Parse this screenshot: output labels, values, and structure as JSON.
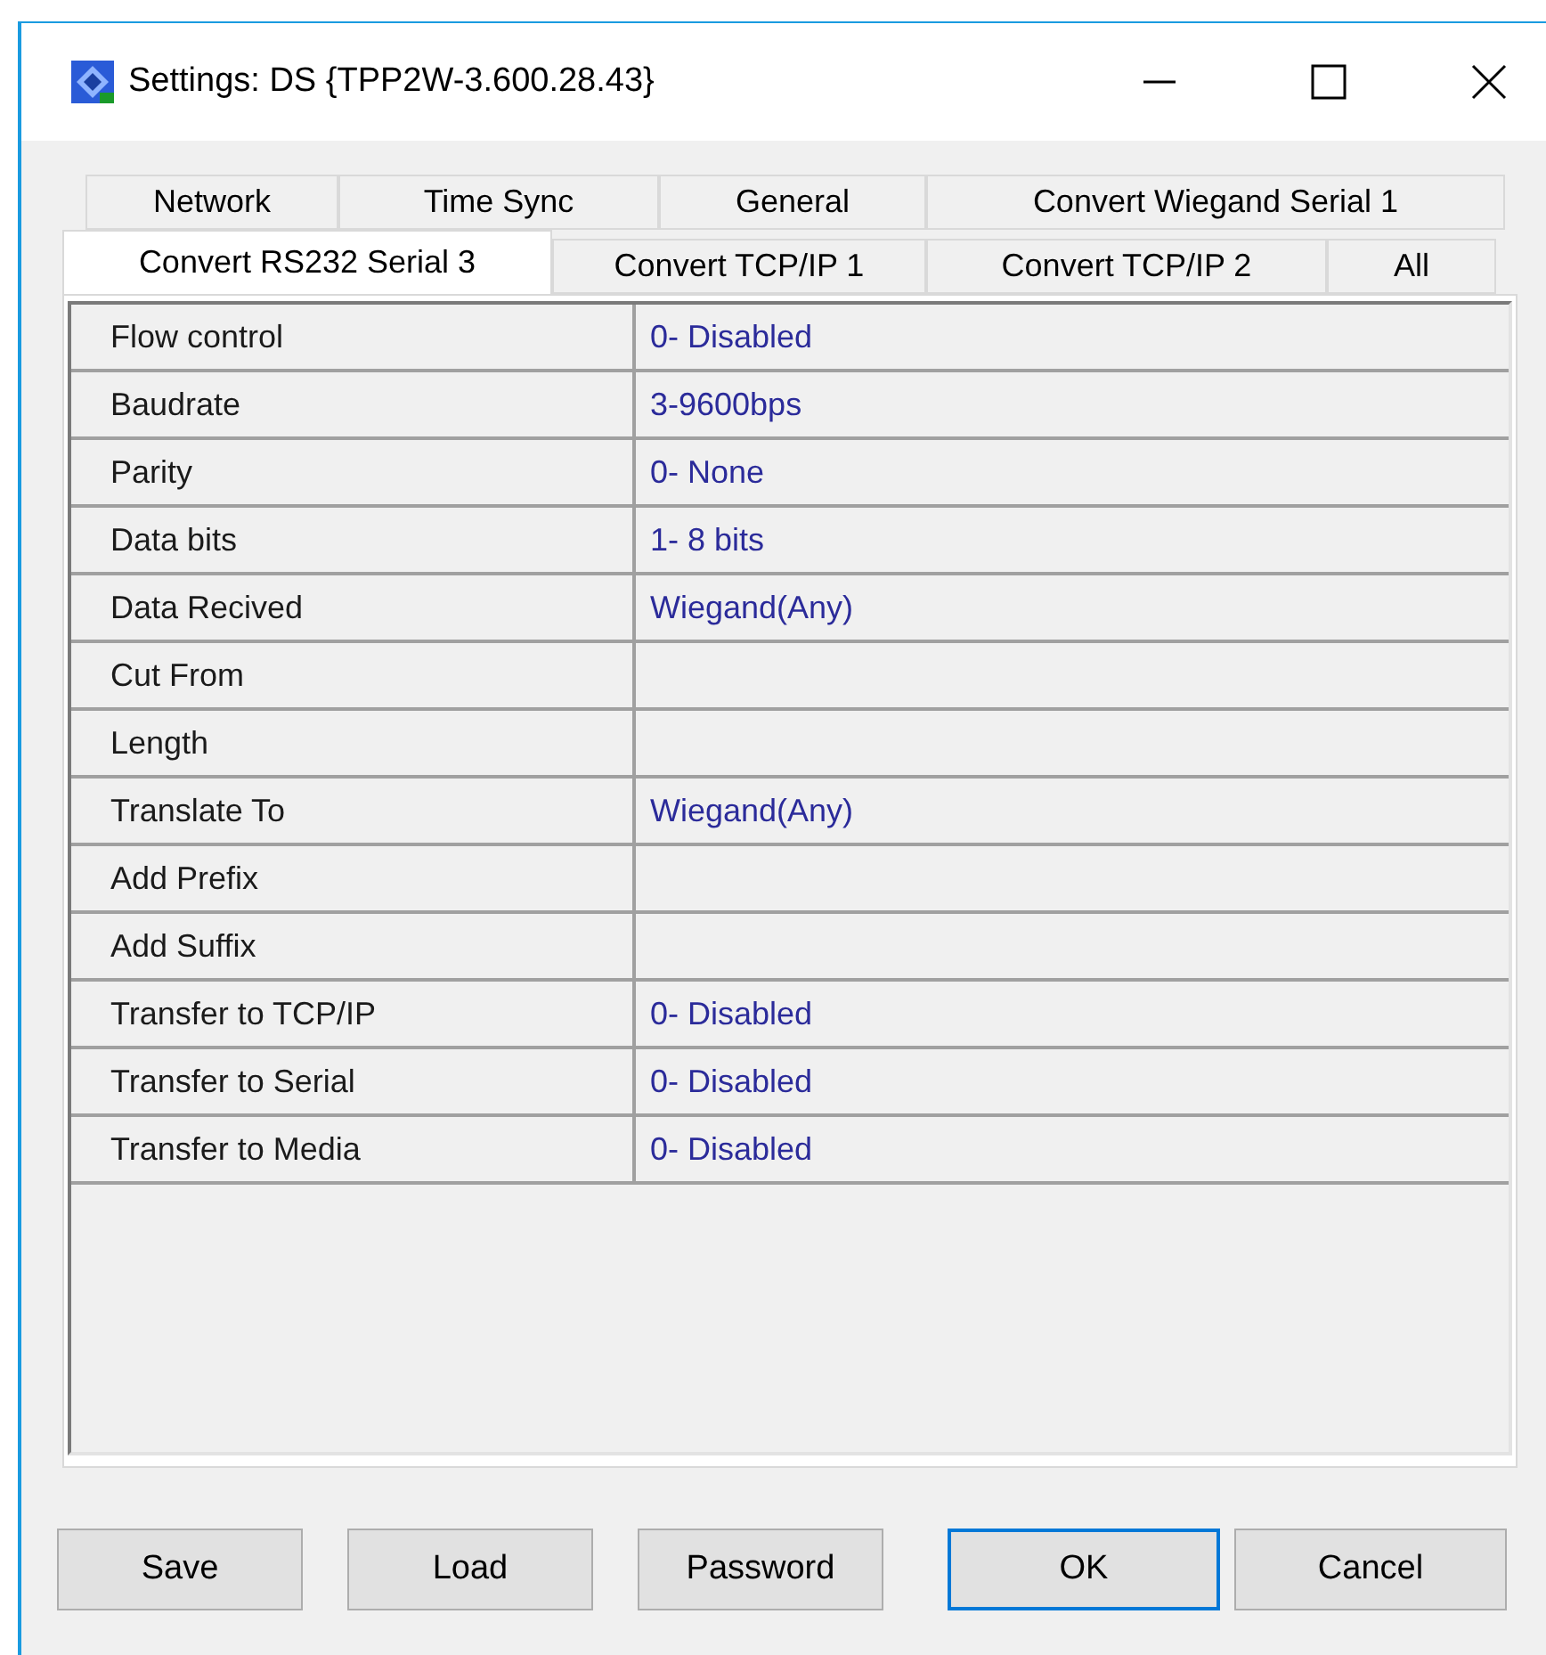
{
  "window": {
    "title": "Settings: DS {TPP2W-3.600.28.43}"
  },
  "tab_rows": [
    [
      {
        "label": "Network",
        "selected": false
      },
      {
        "label": "Time Sync",
        "selected": false
      },
      {
        "label": "General",
        "selected": false
      },
      {
        "label": "Convert Wiegand Serial 1",
        "selected": false
      }
    ],
    [
      {
        "label": "Convert RS232 Serial 3",
        "selected": true
      },
      {
        "label": "Convert TCP/IP 1",
        "selected": false
      },
      {
        "label": "Convert TCP/IP 2",
        "selected": false
      },
      {
        "label": "All",
        "selected": false
      }
    ]
  ],
  "properties": [
    {
      "name": "Flow control",
      "value": "0- Disabled"
    },
    {
      "name": "Baudrate",
      "value": "3-9600bps"
    },
    {
      "name": "Parity",
      "value": "0- None"
    },
    {
      "name": "Data bits",
      "value": "1- 8 bits"
    },
    {
      "name": "Data Recived",
      "value": "Wiegand(Any)"
    },
    {
      "name": "Cut From"
    },
    {
      "name": "Length"
    },
    {
      "name": "Translate To",
      "value": "Wiegand(Any)"
    },
    {
      "name": "Add Prefix"
    },
    {
      "name": "Add Suffix"
    },
    {
      "name": "Transfer to TCP/IP",
      "value": "0- Disabled"
    },
    {
      "name": "Transfer to Serial",
      "value": "0- Disabled"
    },
    {
      "name": "Transfer to Media",
      "value": "0- Disabled"
    }
  ],
  "buttons": [
    {
      "label": "Save",
      "default": false
    },
    {
      "label": "Load",
      "default": false
    },
    {
      "label": "Password",
      "default": false
    },
    {
      "label": "OK",
      "default": true
    },
    {
      "label": "Cancel",
      "default": false
    }
  ]
}
